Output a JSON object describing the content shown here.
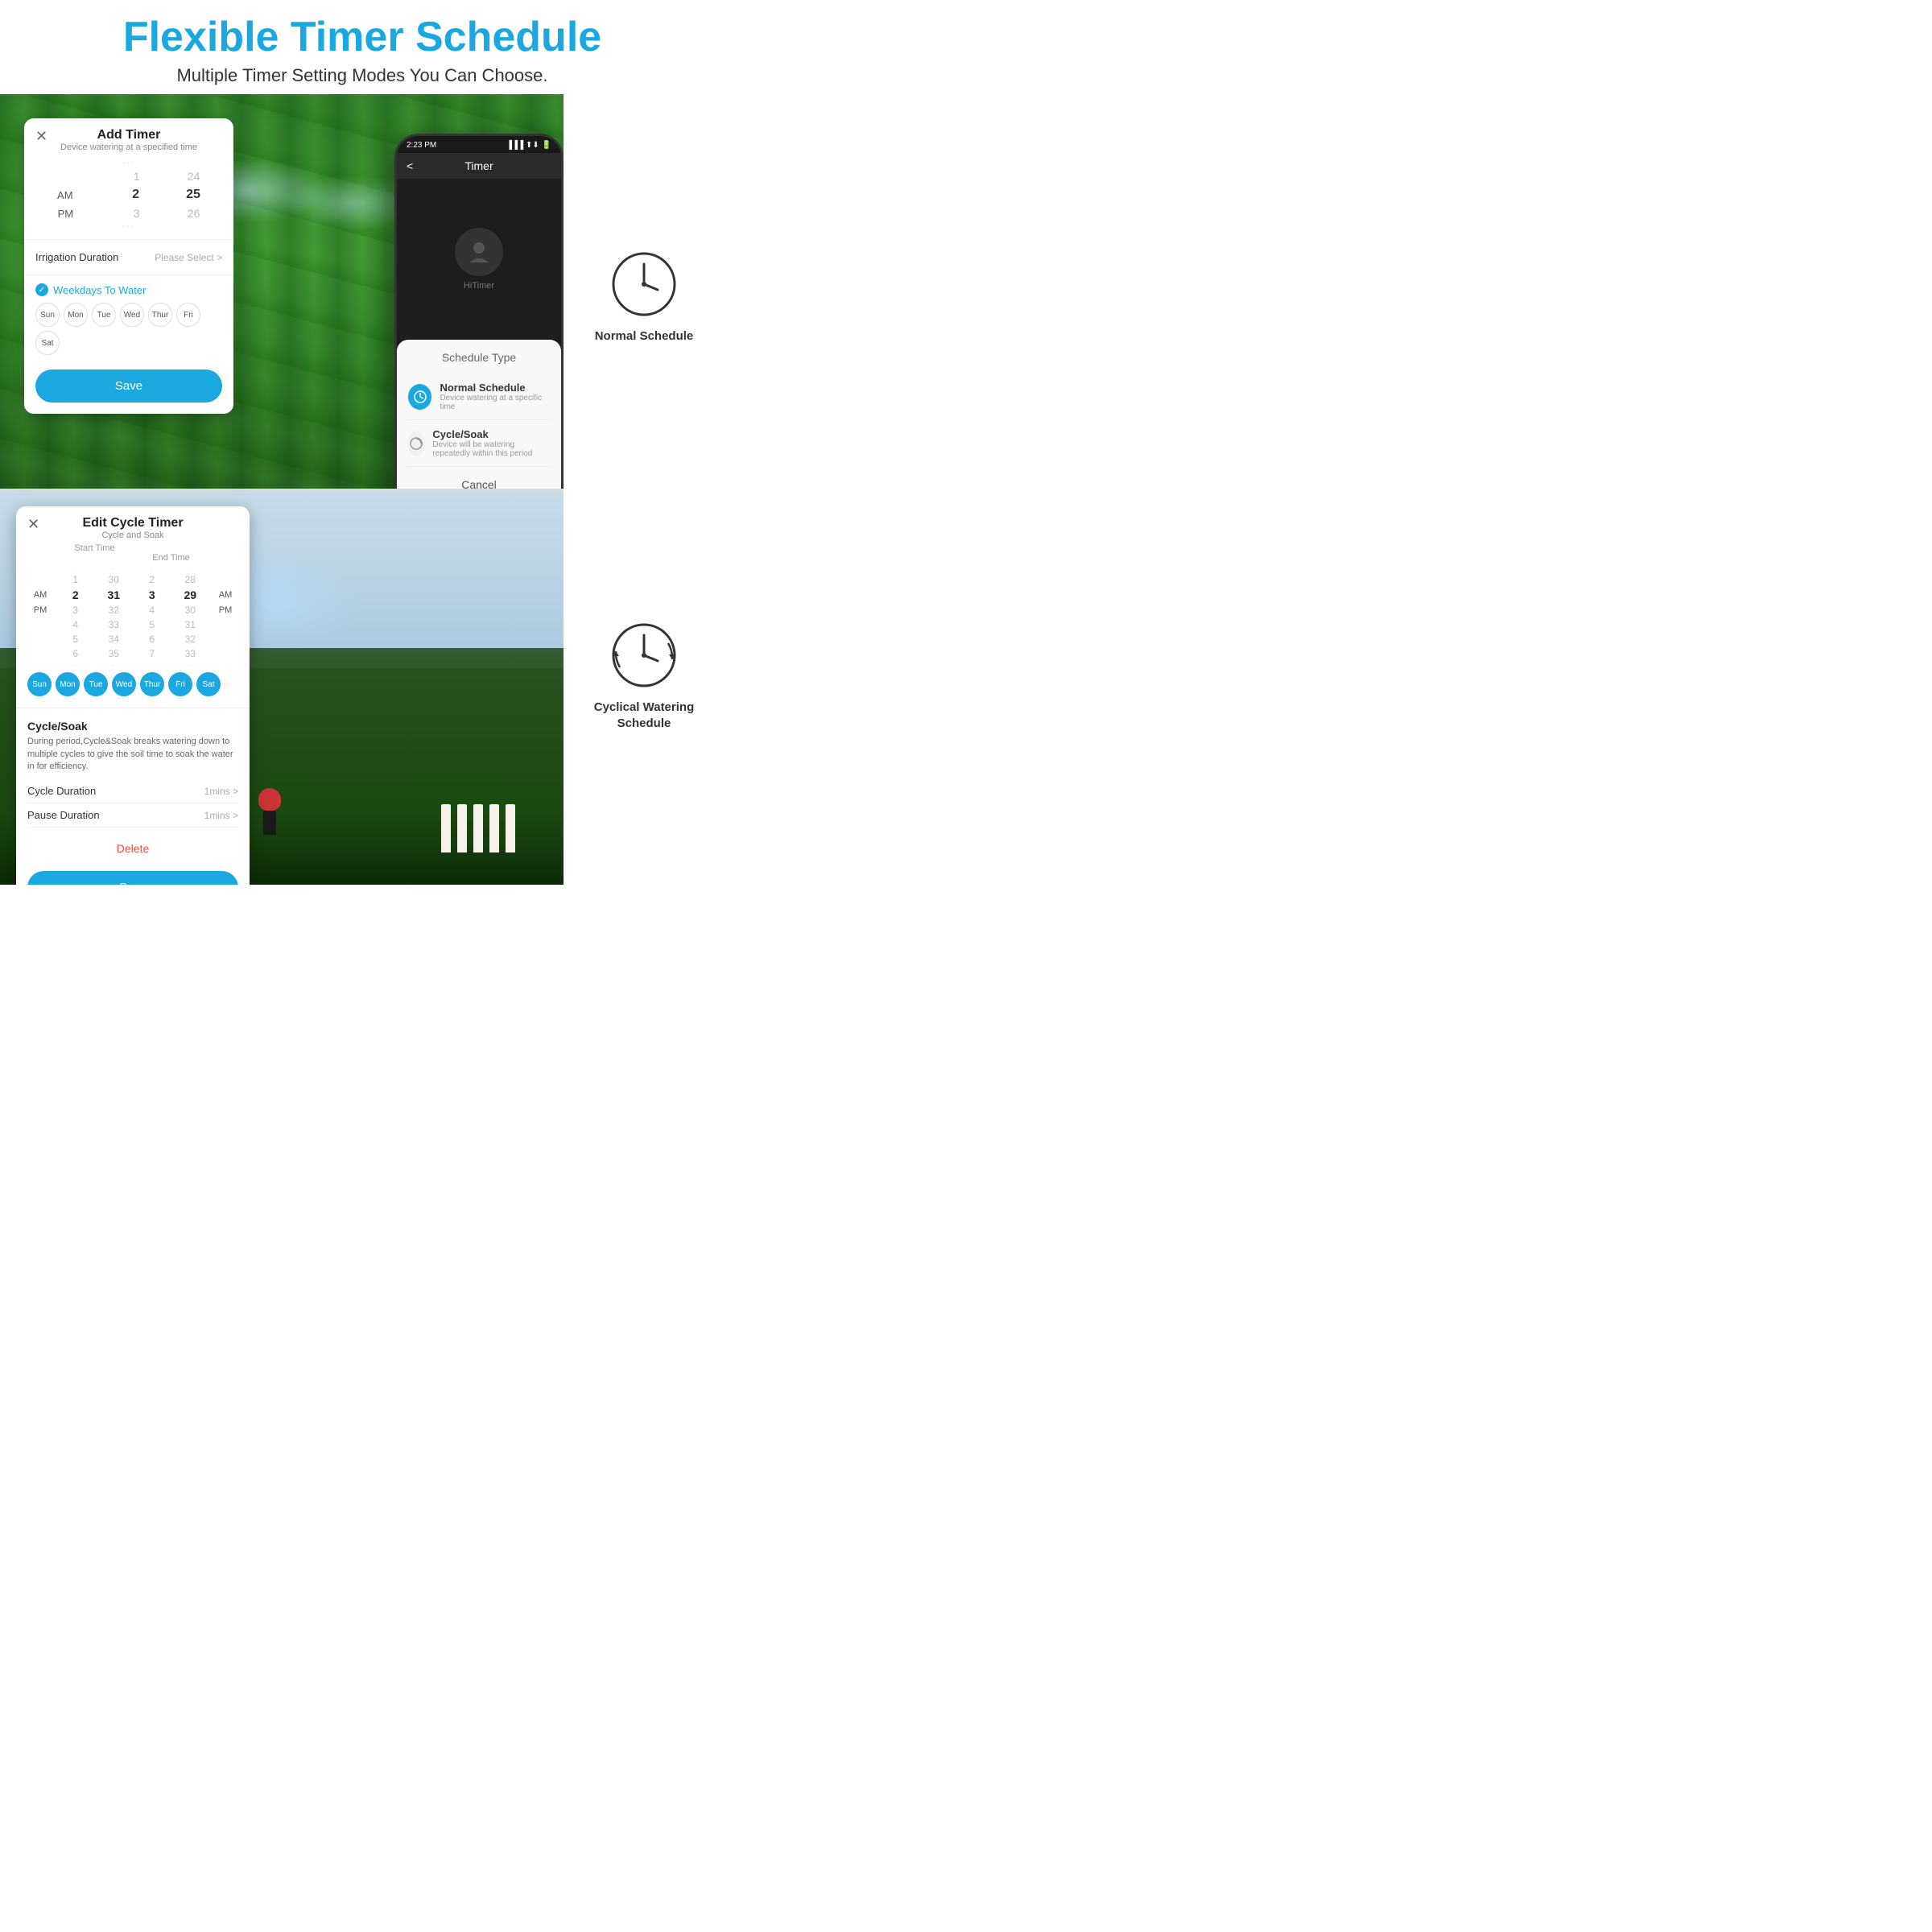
{
  "header": {
    "title": "Flexible Timer Schedule",
    "subtitle": "Multiple Timer Setting Modes You Can Choose."
  },
  "top_card": {
    "close_symbol": "✕",
    "title": "Add Timer",
    "subtitle": "Device watering at a specified time",
    "time_picker": {
      "dots_top": "···",
      "rows": [
        {
          "ampm": "",
          "col1": "1",
          "col2": "24"
        },
        {
          "ampm": "AM",
          "col1": "2",
          "col2": "25",
          "active": true
        },
        {
          "ampm": "PM",
          "col1": "3",
          "col2": "26"
        }
      ],
      "dots_bottom": "···"
    },
    "irrigation_label": "Irrigation Duration",
    "irrigation_value": "Please Select >",
    "weekdays_label": "Weekdays To Water",
    "days": [
      {
        "label": "Sun",
        "selected": false
      },
      {
        "label": "Mon",
        "selected": false
      },
      {
        "label": "Tue",
        "selected": false
      },
      {
        "label": "Wed",
        "selected": false
      },
      {
        "label": "Thur",
        "selected": false
      },
      {
        "label": "Fri",
        "selected": false
      },
      {
        "label": "Sat",
        "selected": false
      }
    ],
    "save_label": "Save"
  },
  "bottom_card": {
    "close_symbol": "✕",
    "title": "Edit Cycle Timer",
    "subtitle": "Cycle and Soak",
    "time_header": {
      "col1": "",
      "col2": "Start Time",
      "col3": "",
      "col4": "End Time",
      "col5": "",
      "col6": ""
    },
    "time_rows": [
      {
        "ampm_left": "",
        "s1": "1",
        "s2": "30",
        "e1": "2",
        "e2": "28",
        "ampm_right": ""
      },
      {
        "ampm_left": "AM",
        "s1": "2",
        "s2": "31",
        "e1": "3",
        "e2": "29",
        "ampm_right": "AM",
        "active": true
      },
      {
        "ampm_left": "PM",
        "s1": "3",
        "s2": "32",
        "e1": "4",
        "e2": "30",
        "ampm_right": "PM"
      },
      {
        "ampm_left": "",
        "s1": "4",
        "s2": "33",
        "e1": "5",
        "e2": "31",
        "ampm_right": ""
      },
      {
        "ampm_left": "",
        "s1": "5",
        "s2": "34",
        "e1": "6",
        "e2": "32",
        "ampm_right": ""
      },
      {
        "ampm_left": "",
        "s1": "6",
        "s2": "35",
        "e1": "7",
        "e2": "33",
        "ampm_right": ""
      }
    ],
    "days": [
      {
        "label": "Sun",
        "selected": true
      },
      {
        "label": "Mon",
        "selected": true
      },
      {
        "label": "Tue",
        "selected": true
      },
      {
        "label": "Wed",
        "selected": true
      },
      {
        "label": "Thur",
        "selected": true
      },
      {
        "label": "Fri",
        "selected": true
      },
      {
        "label": "Sat",
        "selected": true
      }
    ],
    "cycle_soak_title": "Cycle/Soak",
    "cycle_soak_desc": "During period,Cycle&Soak breaks watering down to multiple cycles to give the soil time to soak the water in for efficiency.",
    "cycle_duration_label": "Cycle Duration",
    "cycle_duration_value": "1mins >",
    "pause_duration_label": "Pause  Duration",
    "pause_duration_value": "1mins >",
    "delete_label": "Delete",
    "save_label": "Save"
  },
  "phone": {
    "status_time": "2:23 PM",
    "nav_title": "Timer",
    "nav_back": "<",
    "timer_label": "HiTimer",
    "sheet_title": "Schedule Type",
    "option1_title": "Normal Schedule",
    "option1_desc": "Device watering  at a specific time",
    "option2_title": "Cycle/Soak",
    "option2_desc": "Device will be watering repeatedly within this period",
    "cancel_label": "Cancel"
  },
  "right_col": {
    "items": [
      {
        "label": "Normal Schedule",
        "icon_type": "clock"
      },
      {
        "label": "Cyclical Watering\nSchedule",
        "icon_type": "cycle-clock"
      }
    ]
  }
}
